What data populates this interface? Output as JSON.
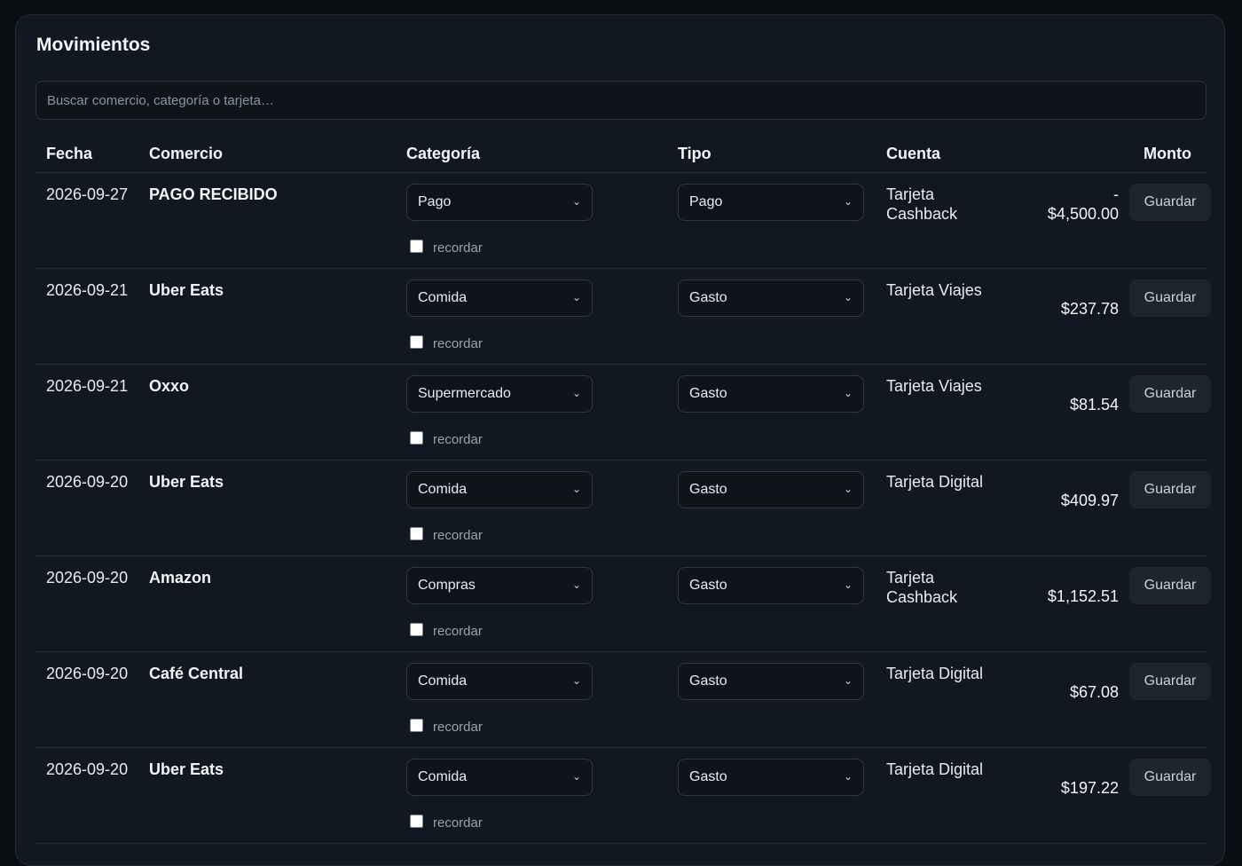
{
  "panel": {
    "title": "Movimientos"
  },
  "search": {
    "placeholder": "Buscar comercio, categoría o tarjeta…"
  },
  "table": {
    "headers": {
      "fecha": "Fecha",
      "comercio": "Comercio",
      "categoria": "Categoría",
      "tipo": "Tipo",
      "cuenta": "Cuenta",
      "monto": "Monto"
    },
    "remember_label": "recordar",
    "save_label": "Guardar",
    "rows": [
      {
        "date": "2026-09-27",
        "merchant": "PAGO RECIBIDO",
        "category": "Pago",
        "type": "Pago",
        "account": "Tarjeta Cashback",
        "amount": "-$4,500.00",
        "remember": false
      },
      {
        "date": "2026-09-21",
        "merchant": "Uber Eats",
        "category": "Comida",
        "type": "Gasto",
        "account": "Tarjeta Viajes",
        "amount": "$237.78",
        "remember": false
      },
      {
        "date": "2026-09-21",
        "merchant": "Oxxo",
        "category": "Supermercado",
        "type": "Gasto",
        "account": "Tarjeta Viajes",
        "amount": "$81.54",
        "remember": false
      },
      {
        "date": "2026-09-20",
        "merchant": "Uber Eats",
        "category": "Comida",
        "type": "Gasto",
        "account": "Tarjeta Digital",
        "amount": "$409.97",
        "remember": false
      },
      {
        "date": "2026-09-20",
        "merchant": "Amazon",
        "category": "Compras",
        "type": "Gasto",
        "account": "Tarjeta Cashback",
        "amount": "$1,152.51",
        "remember": false
      },
      {
        "date": "2026-09-20",
        "merchant": "Café Central",
        "category": "Comida",
        "type": "Gasto",
        "account": "Tarjeta Digital",
        "amount": "$67.08",
        "remember": false
      },
      {
        "date": "2026-09-20",
        "merchant": "Uber Eats",
        "category": "Comida",
        "type": "Gasto",
        "account": "Tarjeta Digital",
        "amount": "$197.22",
        "remember": false
      }
    ]
  }
}
